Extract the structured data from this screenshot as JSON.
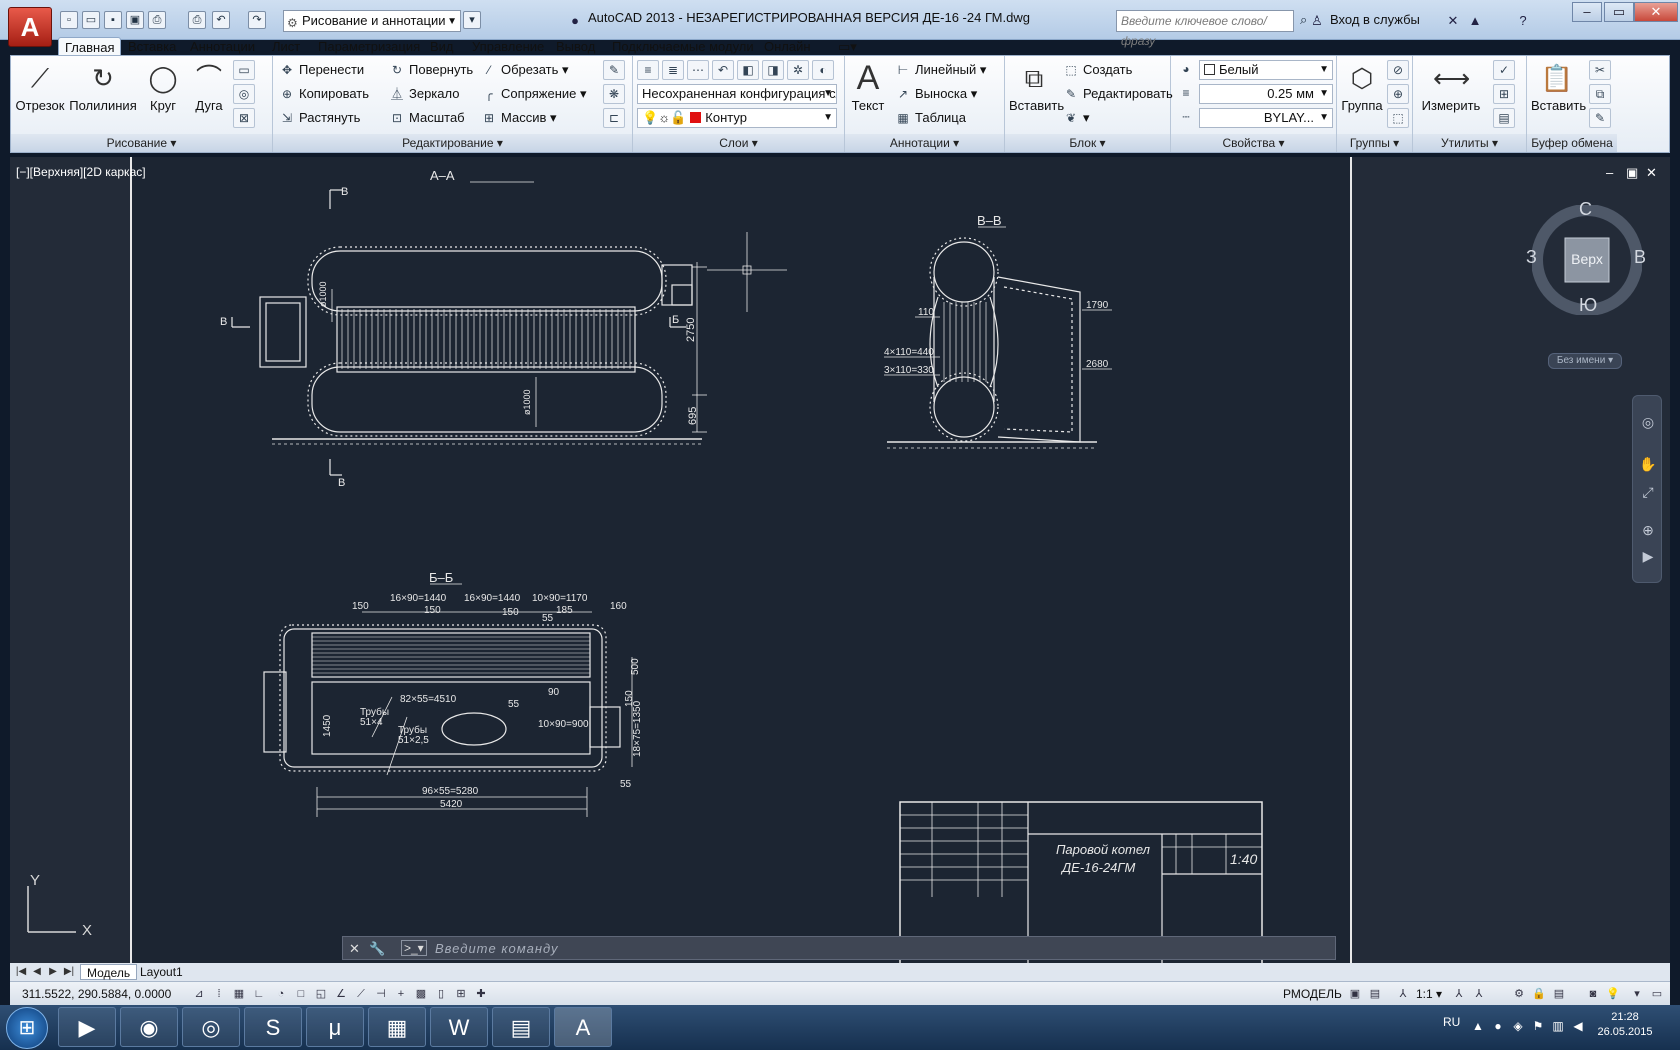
{
  "titlebar": {
    "title": "AutoCAD 2013 - НЕЗАРЕГИСТРИРОВАННАЯ ВЕРСИЯ    ДЕ-16 -24 ГМ.dwg",
    "workspace": "Рисование и аннотации",
    "search_placeholder": "Введите ключевое слово/фразу",
    "signin": "Вход в службы"
  },
  "ribbon_tabs": [
    "Главная",
    "Вставка",
    "Аннотации",
    "Лист",
    "Параметризация",
    "Вид",
    "Управление",
    "Вывод",
    "Подключаемые модули",
    "Онлайн"
  ],
  "panels": {
    "draw": {
      "title": "Рисование",
      "line": "Отрезок",
      "polyline": "Полилиния",
      "circle": "Круг",
      "arc": "Дуга"
    },
    "modify": {
      "title": "Редактирование",
      "move": "Перенести",
      "rotate": "Повернуть",
      "trim": "Обрезать",
      "copy": "Копировать",
      "mirror": "Зеркало",
      "fillet": "Сопряжение",
      "stretch": "Растянуть",
      "scale": "Масштаб",
      "array": "Массив"
    },
    "layers": {
      "title": "Слои",
      "config": "Несохраненная конфигурация слоев",
      "layer": "Контур"
    },
    "annotation": {
      "title": "Аннотации",
      "text": "Текст",
      "linear": "Линейный",
      "leader": "Выноска",
      "table": "Таблица"
    },
    "block": {
      "title": "Блок",
      "insert": "Вставить",
      "create": "Создать",
      "edit": "Редактировать"
    },
    "properties": {
      "title": "Свойства",
      "color": "Белый",
      "lineweight": "0.25 мм",
      "linetype": "BYLAY..."
    },
    "groups": {
      "title": "Группы",
      "group": "Группа"
    },
    "utilities": {
      "title": "Утилиты",
      "measure": "Измерить"
    },
    "clipboard": {
      "title": "Буфер обмена",
      "paste": "Вставить"
    }
  },
  "viewport": {
    "label": "[−][Верхняя][2D каркас]",
    "viewcube": {
      "north": "С",
      "south": "Ю",
      "west": "З",
      "east": "В",
      "face": "Верх",
      "ucs": "Без имени"
    },
    "ucs_x": "X",
    "ucs_y": "Y"
  },
  "drawing": {
    "section_aa": "А–А",
    "section_bb": "Б–Б",
    "section_vv": "В–В",
    "mark_b": "Б",
    "mark_v": "В",
    "dims_aa": [
      "2750",
      "695",
      "ø1000",
      "ø1000"
    ],
    "dims_vv": [
      "110",
      "4×110=440",
      "3×110=330",
      "1790",
      "2680"
    ],
    "dims_bb": [
      "150",
      "16×90=1440",
      "16×90=1440",
      "10×90=1170",
      "160",
      "150",
      "185",
      "150",
      "55",
      "500",
      "82×55=4510",
      "90",
      "55",
      "150",
      "Трубы",
      "51×4",
      "Трубы",
      "51×2,5",
      "10×90=900",
      "18×75=1350",
      "96×55=5280",
      "5420",
      "55",
      "1450"
    ],
    "stamp": {
      "title_line1": "Паровой котел",
      "title_line2": "ДЕ-16-24ГМ",
      "scale": "1:40"
    }
  },
  "command_line": {
    "placeholder": "Введите команду"
  },
  "layout_tabs": [
    "Модель",
    "Layout1"
  ],
  "status": {
    "coords": "311.5522, 290.5884, 0.0000",
    "mode": "РМОДЕЛЬ",
    "scale": "1:1"
  },
  "taskbar": {
    "lang": "RU",
    "time": "21:28",
    "date": "26.05.2015"
  },
  "colors": {
    "model_bg": "#232b38",
    "app_red": "#c6281a",
    "ribbon": "#e6edf5"
  }
}
